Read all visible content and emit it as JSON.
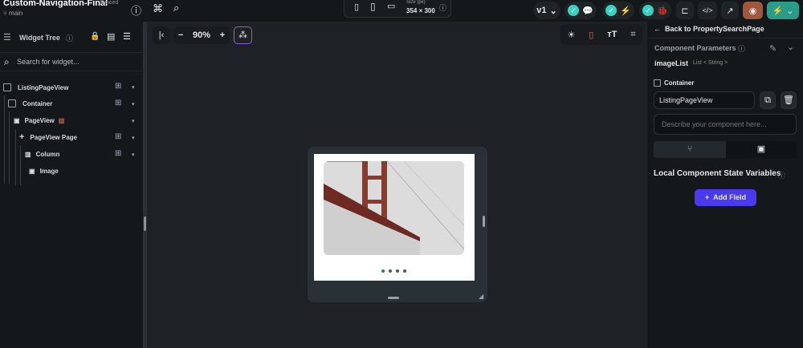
{
  "header": {
    "project_name": "Custom-Navigation-Final",
    "sync_status": "Synced",
    "branch": "main",
    "size_label": "Size (px)",
    "size_value": "354 × 300",
    "version": "v1"
  },
  "left_panel": {
    "title": "Widget Tree",
    "search_placeholder": "Search for widget...",
    "tree": [
      {
        "label": "ListingPageView"
      },
      {
        "label": "Container"
      },
      {
        "label": "PageView"
      },
      {
        "label": "PageView Page"
      },
      {
        "label": "Column"
      },
      {
        "label": "Image"
      }
    ]
  },
  "canvas": {
    "zoom": "90%",
    "page_indicator": {
      "count": 4,
      "active": 1
    },
    "accent": "#39d2c0"
  },
  "right_panel": {
    "back_label": "Back to PropertySearchPage",
    "section_title": "Component Parameters",
    "param_name": "imageList",
    "param_type": "List < String >",
    "root_widget": "Container",
    "component_name": "ListingPageView",
    "description_placeholder": "Describe your component here...",
    "state_title": "Local Component State Variables",
    "add_field": "Add Field"
  }
}
